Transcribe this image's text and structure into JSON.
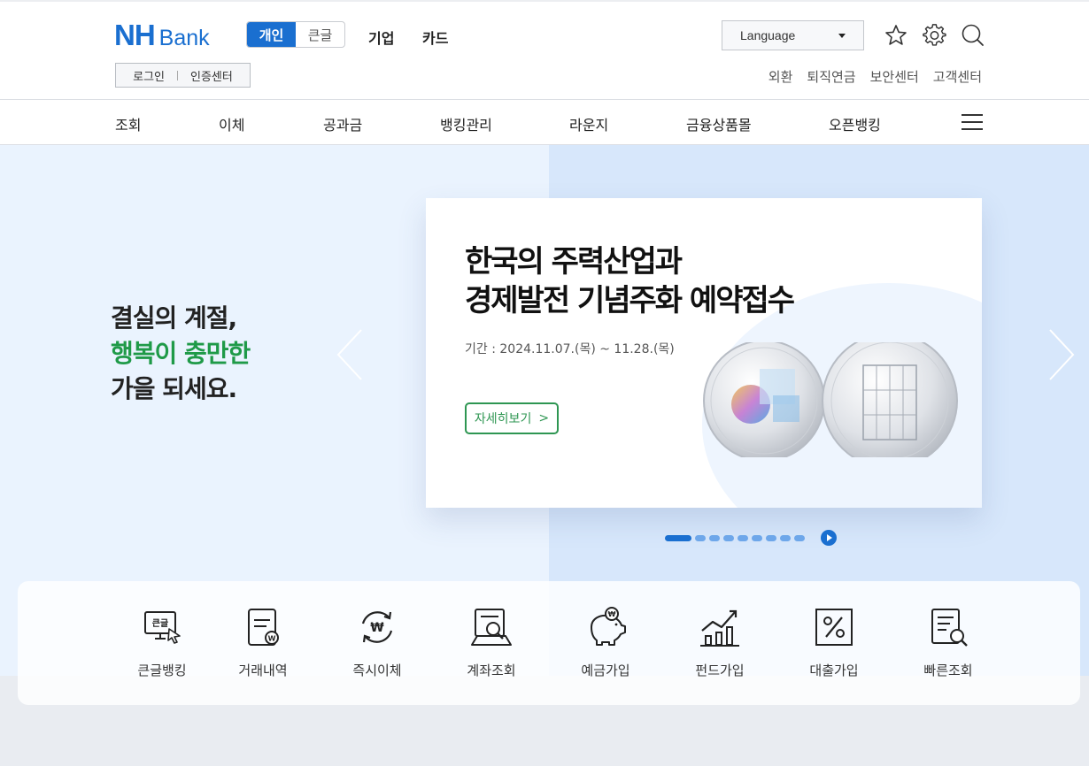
{
  "header": {
    "logo_nh": "NH",
    "logo_bank": "Bank",
    "mode_personal": "개인",
    "mode_largefont": "큰글",
    "links": [
      "기업",
      "카드"
    ],
    "login": "로그인",
    "cert_center": "인증센터",
    "language": "Language",
    "util_links": [
      "외환",
      "퇴직연금",
      "보안센터",
      "고객센터"
    ],
    "icons": [
      "star-icon",
      "gear-icon",
      "search-icon"
    ]
  },
  "gnb": {
    "items": [
      "조회",
      "이체",
      "공과금",
      "뱅킹관리",
      "라운지",
      "금융상품몰",
      "오픈뱅킹"
    ]
  },
  "hero": {
    "slogan_line1": "결실의 계절,",
    "slogan_line2": "행복이 충만한",
    "slogan_line3": "가을 되세요.",
    "slogan_accent_color": "#1f9a48",
    "banner": {
      "title_line1": "한국의 주력산업과",
      "title_line2": "경제발전 기념주화 예약접수",
      "period": "기간 : 2024.11.07.(목) ~ 11.28.(목)",
      "button": "자세히보기",
      "button_arrow": ">"
    },
    "pager": {
      "total": 9,
      "active": 1
    }
  },
  "quick_menu": {
    "items": [
      {
        "label": "큰글뱅킹",
        "icon": "large-font-banking-icon",
        "icon_text": "큰글"
      },
      {
        "label": "거래내역",
        "icon": "transaction-history-icon",
        "icon_text": "W"
      },
      {
        "label": "즉시이체",
        "icon": "instant-transfer-icon",
        "icon_text": "₩"
      },
      {
        "label": "계좌조회",
        "icon": "account-inquiry-icon"
      },
      {
        "label": "예금가입",
        "icon": "piggy-bank-icon",
        "icon_text": "₩"
      },
      {
        "label": "펀드가입",
        "icon": "fund-chart-icon"
      },
      {
        "label": "대출가입",
        "icon": "loan-percent-icon"
      },
      {
        "label": "빠른조회",
        "icon": "quick-inquiry-icon"
      }
    ]
  },
  "colors": {
    "brand_blue": "#1a6fd0",
    "green": "#2e9652"
  }
}
